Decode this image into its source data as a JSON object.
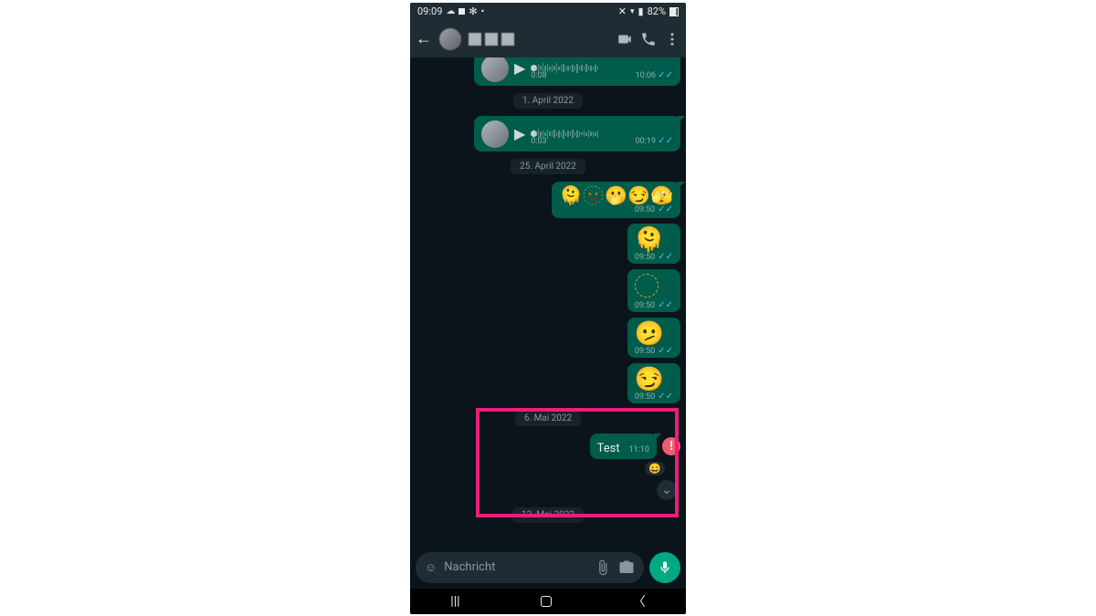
{
  "statusbar": {
    "time": "09:09",
    "battery": "82%"
  },
  "dates": {
    "d1": "1. April 2022",
    "d2": "25. April 2022",
    "d3": "6. Mai 2022",
    "d4": "12. Mai 2022"
  },
  "voice1": {
    "duration": "0:08",
    "time": "10:06"
  },
  "voice2": {
    "duration": "0:03",
    "time": "00:19"
  },
  "emojis": {
    "row": "🫠🫥🫢😏🫣",
    "m1": "🫠",
    "m3": "🫤",
    "m4": "😏",
    "time": "09:50"
  },
  "test": {
    "text": "Test",
    "time": "11:10",
    "reaction": "😄"
  },
  "composer": {
    "placeholder": "Nachricht"
  }
}
